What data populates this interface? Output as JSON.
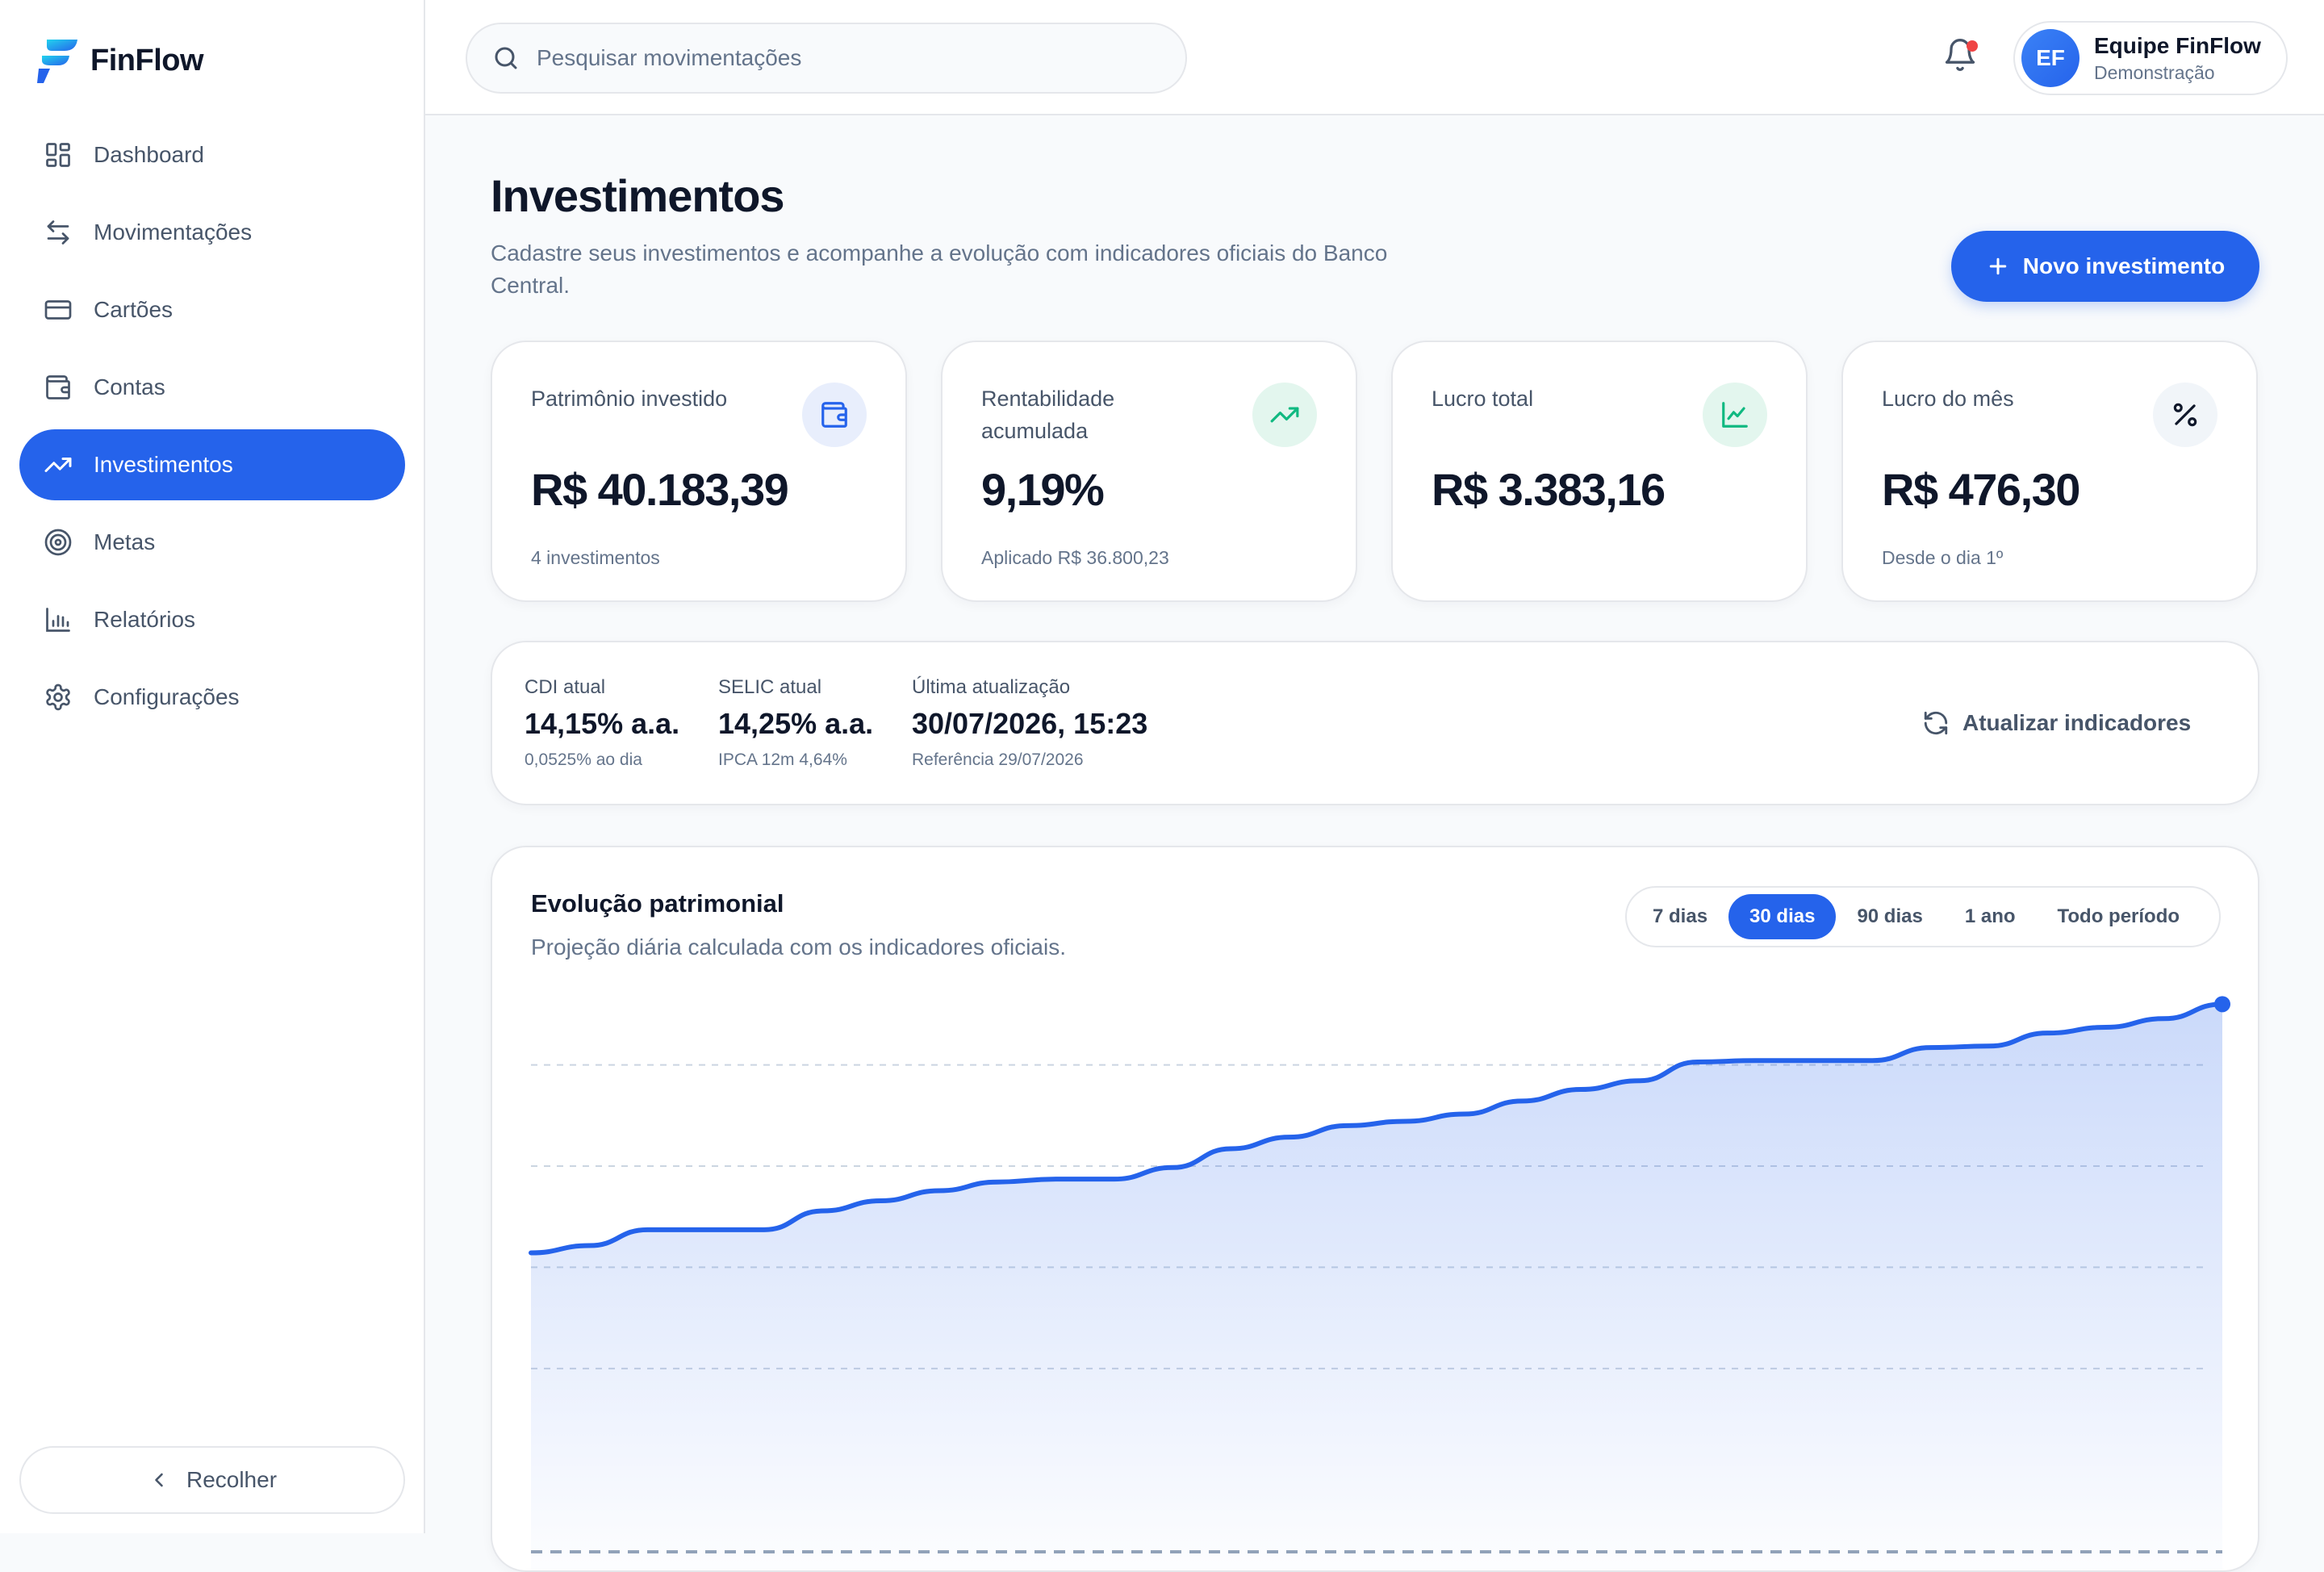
{
  "brand": {
    "name": "FinFlow"
  },
  "sidebar": {
    "items": [
      {
        "label": "Dashboard",
        "icon": "dashboard-icon"
      },
      {
        "label": "Movimentações",
        "icon": "transfer-arrows-icon"
      },
      {
        "label": "Cartões",
        "icon": "credit-card-icon"
      },
      {
        "label": "Contas",
        "icon": "wallet-icon"
      },
      {
        "label": "Investimentos",
        "icon": "trending-up-icon",
        "active": true
      },
      {
        "label": "Metas",
        "icon": "target-icon"
      },
      {
        "label": "Relatórios",
        "icon": "bar-chart-icon"
      },
      {
        "label": "Configurações",
        "icon": "gear-icon"
      }
    ],
    "collapse_label": "Recolher"
  },
  "header": {
    "search_placeholder": "Pesquisar movimentações",
    "user": {
      "initials": "EF",
      "name": "Equipe FinFlow",
      "role": "Demonstração"
    }
  },
  "page": {
    "title": "Investimentos",
    "subtitle": "Cadastre seus investimentos e acompanhe a evolução com indicadores oficiais do Banco Central.",
    "new_button": "Novo investimento"
  },
  "kpis": [
    {
      "label": "Patrimônio investido",
      "value": "R$ 40.183,39",
      "note": "4 investimentos",
      "icon": "wallet-icon"
    },
    {
      "label": "Rentabilidade acumulada",
      "value": "9,19%",
      "note": "Aplicado R$ 36.800,23",
      "icon": "trending-up-icon"
    },
    {
      "label": "Lucro total",
      "value": "R$ 3.383,16",
      "note": "",
      "icon": "line-chart-icon"
    },
    {
      "label": "Lucro do mês",
      "value": "R$ 476,30",
      "note": "Desde o dia 1º",
      "icon": "percent-icon"
    }
  ],
  "indicators": {
    "items": [
      {
        "label": "CDI atual",
        "value": "14,15% a.a.",
        "sub": "0,0525% ao dia"
      },
      {
        "label": "SELIC atual",
        "value": "14,25% a.a.",
        "sub": "IPCA 12m 4,64%"
      },
      {
        "label": "Última atualização",
        "value": "30/07/2026, 15:23",
        "sub": "Referência 29/07/2026"
      }
    ],
    "refresh_label": "Atualizar indicadores"
  },
  "chart": {
    "title": "Evolução patrimonial",
    "subtitle": "Projeção diária calculada com os indicadores oficiais.",
    "ranges": [
      "7 dias",
      "30 dias",
      "90 dias",
      "1 ano",
      "Todo período"
    ],
    "active_range": "30 dias"
  },
  "colors": {
    "accent": "#2563eb",
    "danger": "#ef4444",
    "success": "#10b981"
  },
  "chart_data": {
    "type": "area",
    "title": "Evolução patrimonial",
    "xlabel": "",
    "ylabel": "",
    "grid": true,
    "x": [
      1,
      2,
      3,
      4,
      5,
      6,
      7,
      8,
      9,
      10,
      11,
      12,
      13,
      14,
      15,
      16,
      17,
      18,
      19,
      20,
      21,
      22,
      23,
      24,
      25,
      26,
      27,
      28,
      29,
      30
    ],
    "values": [
      36800,
      36850,
      36960,
      36960,
      36960,
      37090,
      37160,
      37230,
      37290,
      37310,
      37310,
      37390,
      37520,
      37600,
      37680,
      37710,
      37760,
      37850,
      37930,
      37990,
      38120,
      38130,
      38130,
      38130,
      38220,
      38230,
      38320,
      38360,
      38420,
      38520
    ],
    "ylim": [
      35000,
      38600
    ]
  }
}
